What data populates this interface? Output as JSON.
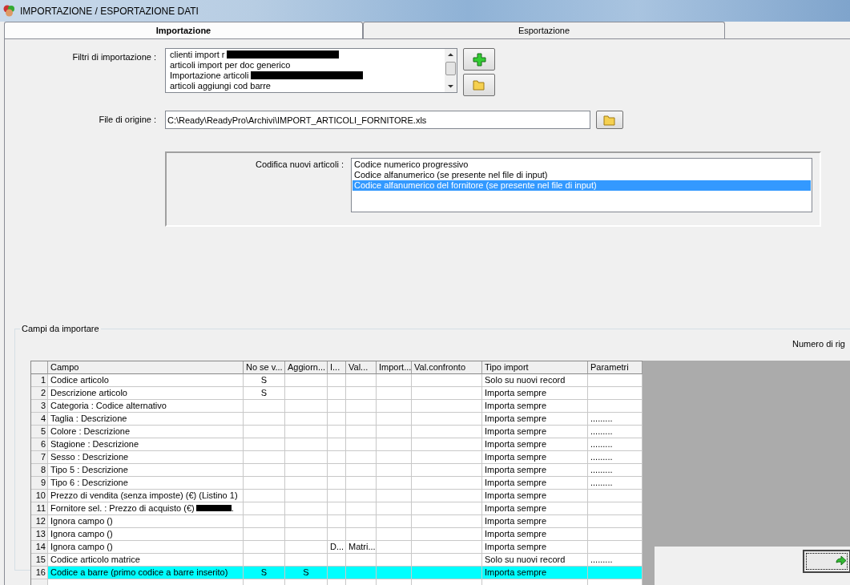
{
  "window": {
    "title": "IMPORTAZIONE / ESPORTAZIONE DATI"
  },
  "tabs": [
    {
      "label": "Importazione",
      "selected": true
    },
    {
      "label": "Esportazione",
      "selected": false
    }
  ],
  "import_filters": {
    "label": "Filtri di importazione :",
    "items": [
      {
        "text": "clienti import r",
        "redacted": true,
        "selected": false
      },
      {
        "text": "articoli import per doc generico",
        "redacted": false,
        "selected": false
      },
      {
        "text": "Importazione articoli",
        "redacted": true,
        "selected": false
      },
      {
        "text": "articoli aggiungi cod barre",
        "redacted": false,
        "selected": false
      }
    ]
  },
  "source_file": {
    "label": "File di origine :",
    "value": "C:\\Ready\\ReadyPro\\Archivi\\IMPORT_ARTICOLI_FORNITORE.xls"
  },
  "new_item_coding": {
    "label": "Codifica nuovi articoli :",
    "options": [
      {
        "text": "Codice numerico progressivo",
        "selected": false
      },
      {
        "text": "Codice alfanumerico (se presente nel file di input)",
        "selected": false
      },
      {
        "text": "Codice alfanumerico del fornitore (se presente nel file di input)",
        "selected": true
      }
    ]
  },
  "fields_group": {
    "title": "Campi da importare",
    "row_count_label": "Numero di rig",
    "table": {
      "columns": [
        "Campo",
        "No se v...",
        "Aggiorn...",
        "I...",
        "Val...",
        "Import...",
        "Val.confronto",
        "Tipo import",
        "Parametri"
      ],
      "rows": [
        {
          "number": "1",
          "cells": [
            "Codice articolo",
            "S",
            null,
            null,
            null,
            null,
            null,
            "Solo su nuovi record",
            null
          ],
          "selected": false
        },
        {
          "number": "2",
          "cells": [
            "Descrizione articolo",
            "S",
            null,
            null,
            null,
            null,
            null,
            "Importa sempre",
            null
          ],
          "selected": false
        },
        {
          "number": "3",
          "cells": [
            "Categoria : Codice alternativo",
            null,
            null,
            null,
            null,
            null,
            null,
            "Importa sempre",
            null
          ],
          "selected": false
        },
        {
          "number": "4",
          "cells": [
            "Taglia : Descrizione",
            null,
            null,
            null,
            null,
            null,
            null,
            "Importa sempre",
            "........."
          ],
          "selected": false
        },
        {
          "number": "5",
          "cells": [
            "Colore : Descrizione",
            null,
            null,
            null,
            null,
            null,
            null,
            "Importa sempre",
            "........."
          ],
          "selected": false
        },
        {
          "number": "6",
          "cells": [
            "Stagione : Descrizione",
            null,
            null,
            null,
            null,
            null,
            null,
            "Importa sempre",
            "........."
          ],
          "selected": false
        },
        {
          "number": "7",
          "cells": [
            "Sesso : Descrizione",
            null,
            null,
            null,
            null,
            null,
            null,
            "Importa sempre",
            "........."
          ],
          "selected": false
        },
        {
          "number": "8",
          "cells": [
            "Tipo 5 : Descrizione",
            null,
            null,
            null,
            null,
            null,
            null,
            "Importa sempre",
            "........."
          ],
          "selected": false
        },
        {
          "number": "9",
          "cells": [
            "Tipo 6 : Descrizione",
            null,
            null,
            null,
            null,
            null,
            null,
            "Importa sempre",
            "........."
          ],
          "selected": false
        },
        {
          "number": "10",
          "cells": [
            "Prezzo di vendita (senza imposte) (€) (Listino 1)",
            null,
            null,
            null,
            null,
            null,
            null,
            "Importa sempre",
            null
          ],
          "selected": false
        },
        {
          "number": "11",
          "cells": [
            "Fornitore sel. : Prezzo di acquisto (€)",
            null,
            null,
            null,
            null,
            null,
            null,
            "Importa sempre",
            null
          ],
          "redacted": true,
          "after_redaction": ".",
          "selected": false
        },
        {
          "number": "12",
          "cells": [
            "Ignora campo ()",
            null,
            null,
            null,
            null,
            null,
            null,
            "Importa sempre",
            null
          ],
          "selected": false
        },
        {
          "number": "13",
          "cells": [
            "Ignora campo ()",
            null,
            null,
            null,
            null,
            null,
            null,
            "Importa sempre",
            null
          ],
          "selected": false
        },
        {
          "number": "14",
          "cells": [
            "Ignora campo ()",
            null,
            null,
            "D...",
            "Matri...",
            null,
            null,
            "Importa sempre",
            null
          ],
          "selected": false
        },
        {
          "number": "15",
          "cells": [
            "Codice articolo matrice",
            null,
            null,
            null,
            null,
            null,
            null,
            "Solo su nuovi record",
            "........."
          ],
          "selected": false
        },
        {
          "number": "16",
          "cells": [
            "Codice a barre (primo codice a barre inserito)",
            "S",
            "S",
            null,
            null,
            null,
            null,
            "Importa sempre",
            null
          ],
          "selected": true
        }
      ]
    }
  }
}
